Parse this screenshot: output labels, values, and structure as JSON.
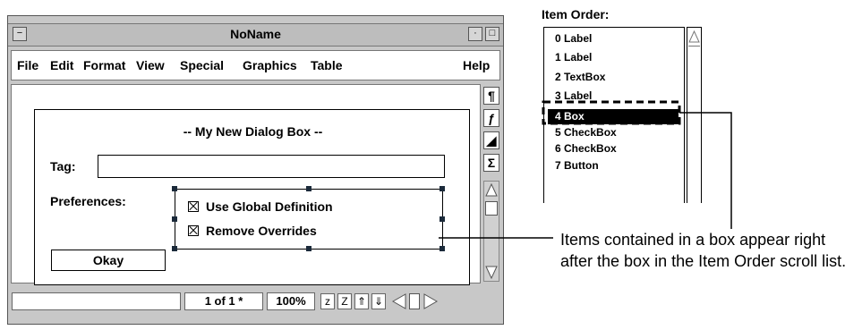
{
  "window": {
    "title": "NoName",
    "menu": [
      "File",
      "Edit",
      "Format",
      "View",
      "Special",
      "Graphics",
      "Table",
      "Help"
    ],
    "tools": [
      "¶",
      "ƒ",
      "◢",
      "Σ"
    ],
    "status": {
      "page": "1 of 1 *",
      "zoom": "100%",
      "zoom_out": "z",
      "zoom_in": "Z"
    }
  },
  "dialog": {
    "title": "-- My New Dialog Box --",
    "tag_label": "Tag:",
    "tag_value": "",
    "preferences_label": "Preferences:",
    "checkboxes": [
      "Use Global Definition",
      "Remove Overrides"
    ],
    "okay_label": "Okay"
  },
  "item_order": {
    "title": "Item Order:",
    "items": [
      "0 Label",
      "1 Label",
      "2 TextBox",
      "3 Label",
      "4 Box",
      "5 CheckBox",
      "6 CheckBox",
      "7 Button"
    ],
    "selected_index": 4
  },
  "annotation": "Items contained in a box appear right after the box in the Item Order scroll list."
}
